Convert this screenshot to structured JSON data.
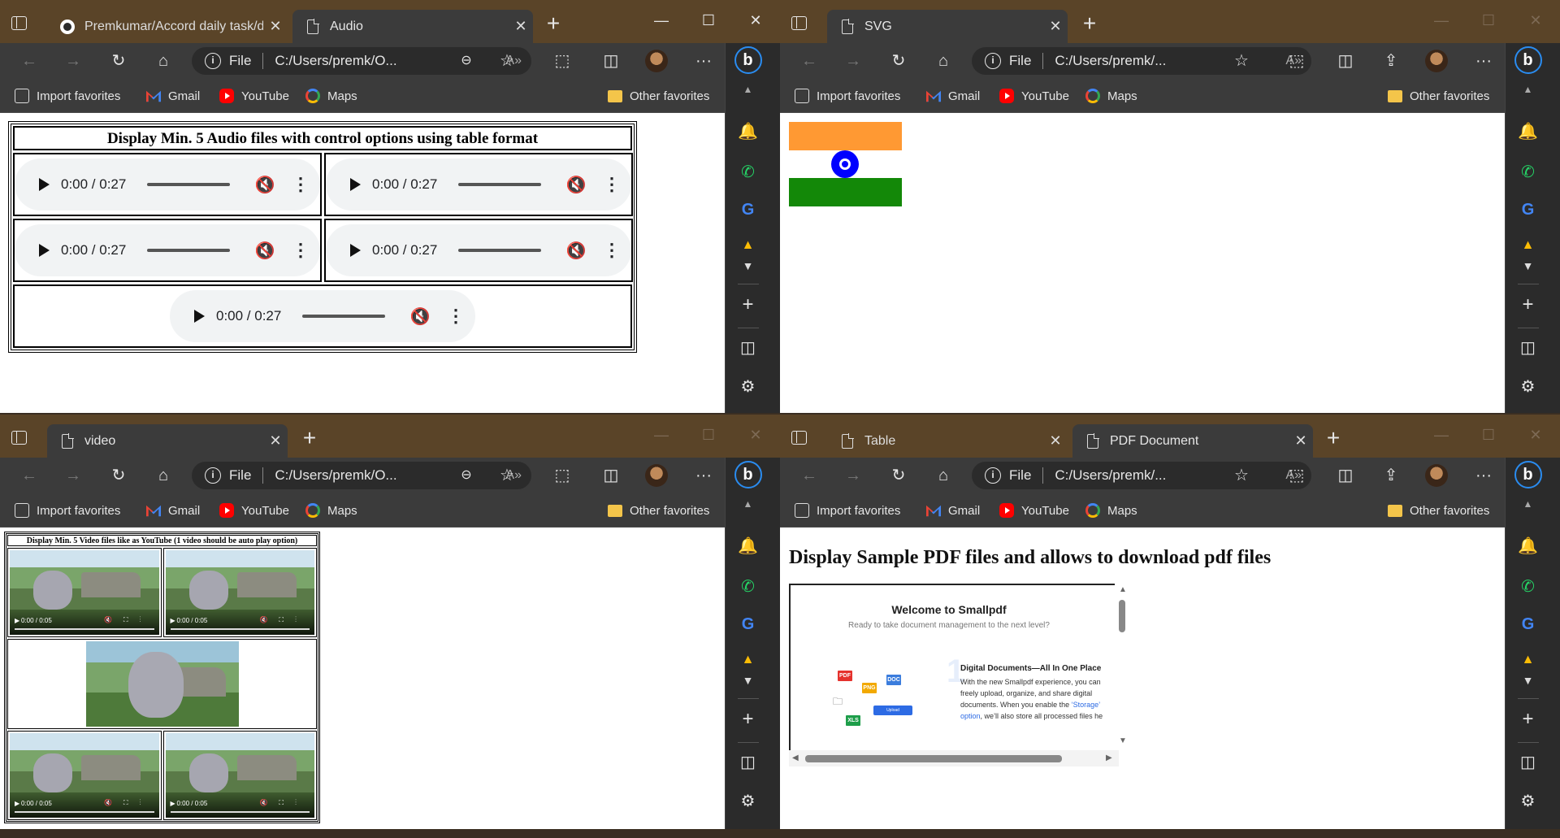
{
  "common": {
    "bookmarks": [
      {
        "label": "Import favorites",
        "icon": "import-icon"
      },
      {
        "label": "Gmail",
        "icon": "gmail-icon"
      },
      {
        "label": "YouTube",
        "icon": "youtube-icon"
      },
      {
        "label": "Maps",
        "icon": "google-maps-icon"
      }
    ],
    "other_favorites": "Other favorites",
    "file_label": "File",
    "read_aloud": "A̓",
    "more": "···",
    "bing": "b"
  },
  "audio_window": {
    "tabs": [
      {
        "title": "Premkumar/Accord daily task/da",
        "icon": "github-icon"
      },
      {
        "title": "Audio",
        "icon": "page-icon"
      }
    ],
    "url": "C:/Users/premk/O...",
    "caption": "Display Min. 5 Audio files with control options using table format",
    "players": [
      {
        "time": "0:00 / 0:27"
      },
      {
        "time": "0:00 / 0:27"
      },
      {
        "time": "0:00 / 0:27"
      },
      {
        "time": "0:00 / 0:27"
      },
      {
        "time": "0:00 / 0:27"
      }
    ]
  },
  "svg_window": {
    "tabs": [
      {
        "title": "SVG",
        "icon": "page-icon"
      }
    ],
    "url": "C:/Users/premk/...",
    "flag_colors": {
      "saffron": "#FF9933",
      "white": "#FFFFFF",
      "green": "#138808",
      "chakra": "#0000FF"
    }
  },
  "video_window": {
    "tabs": [
      {
        "title": "video",
        "icon": "page-icon"
      }
    ],
    "url": "C:/Users/premk/O...",
    "caption": "Display Min. 5 Video files like as YouTube (1 video should be auto play option)",
    "videos": [
      {
        "time": "0:00 / 0:05"
      },
      {
        "time": "0:00 / 0:05"
      },
      {
        "time": "0:00 / 0:05"
      },
      {
        "time": "0:00 / 0:05"
      }
    ]
  },
  "pdf_window": {
    "tabs": [
      {
        "title": "Table",
        "icon": "page-icon"
      },
      {
        "title": "PDF Document",
        "icon": "page-icon"
      }
    ],
    "url": "C:/Users/premk/...",
    "heading": "Display Sample PDF files and allows to download pdf files",
    "pdf": {
      "welcome_title": "Welcome to Smallpdf",
      "welcome_sub": "Ready to take document management to the next level?",
      "section_number": "1",
      "section_heading": "Digital Documents—All In One Place",
      "section_body": "With the new Smallpdf experience, you can freely upload, organize, and share digital documents. When you enable the ",
      "section_link": "‘Storage’ option",
      "section_tail": ", we’ll also store all processed files he",
      "file_badges": [
        "PDF",
        "PNG",
        "DOC",
        "XLS"
      ],
      "upload_label": "Upload"
    }
  }
}
